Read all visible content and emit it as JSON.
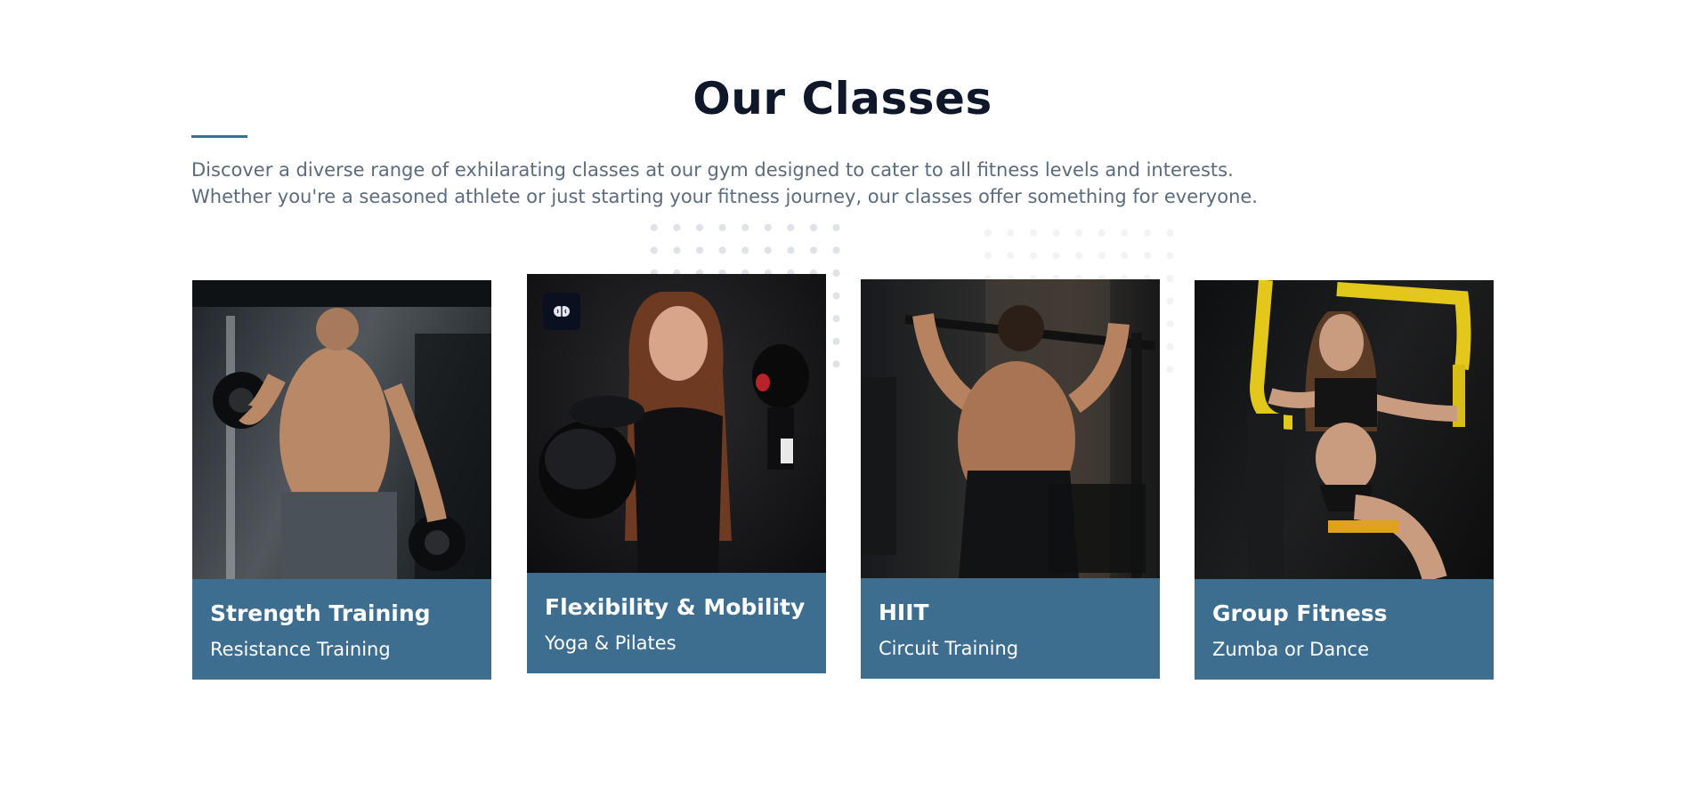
{
  "section": {
    "title": "Our Classes",
    "description_line1": "Discover a diverse range of exhilarating classes at our gym designed to cater to all fitness levels and interests.",
    "description_line2": "Whether you're a seasoned athlete or just starting your fitness journey, our classes offer something for everyone."
  },
  "colors": {
    "heading": "#0f172a",
    "accent": "#3d6e8f",
    "body_text": "#5b6b7d",
    "card_caption_bg": "#3d6e8f",
    "caption_text": "#ffffff"
  },
  "classes": [
    {
      "title": "Strength Training",
      "subtitle": "Resistance Training",
      "image": "man-lifting-dumbbells-photo"
    },
    {
      "title": "Flexibility & Mobility",
      "subtitle": "Yoga & Pilates",
      "image": "woman-boxing-gloves-photo",
      "badge_icon": "brain-icon"
    },
    {
      "title": "HIIT",
      "subtitle": "Circuit Training",
      "image": "man-pull-up-photo"
    },
    {
      "title": "Group Fitness",
      "subtitle": "Zumba or Dance",
      "image": "woman-chest-fly-machine-photo"
    }
  ]
}
